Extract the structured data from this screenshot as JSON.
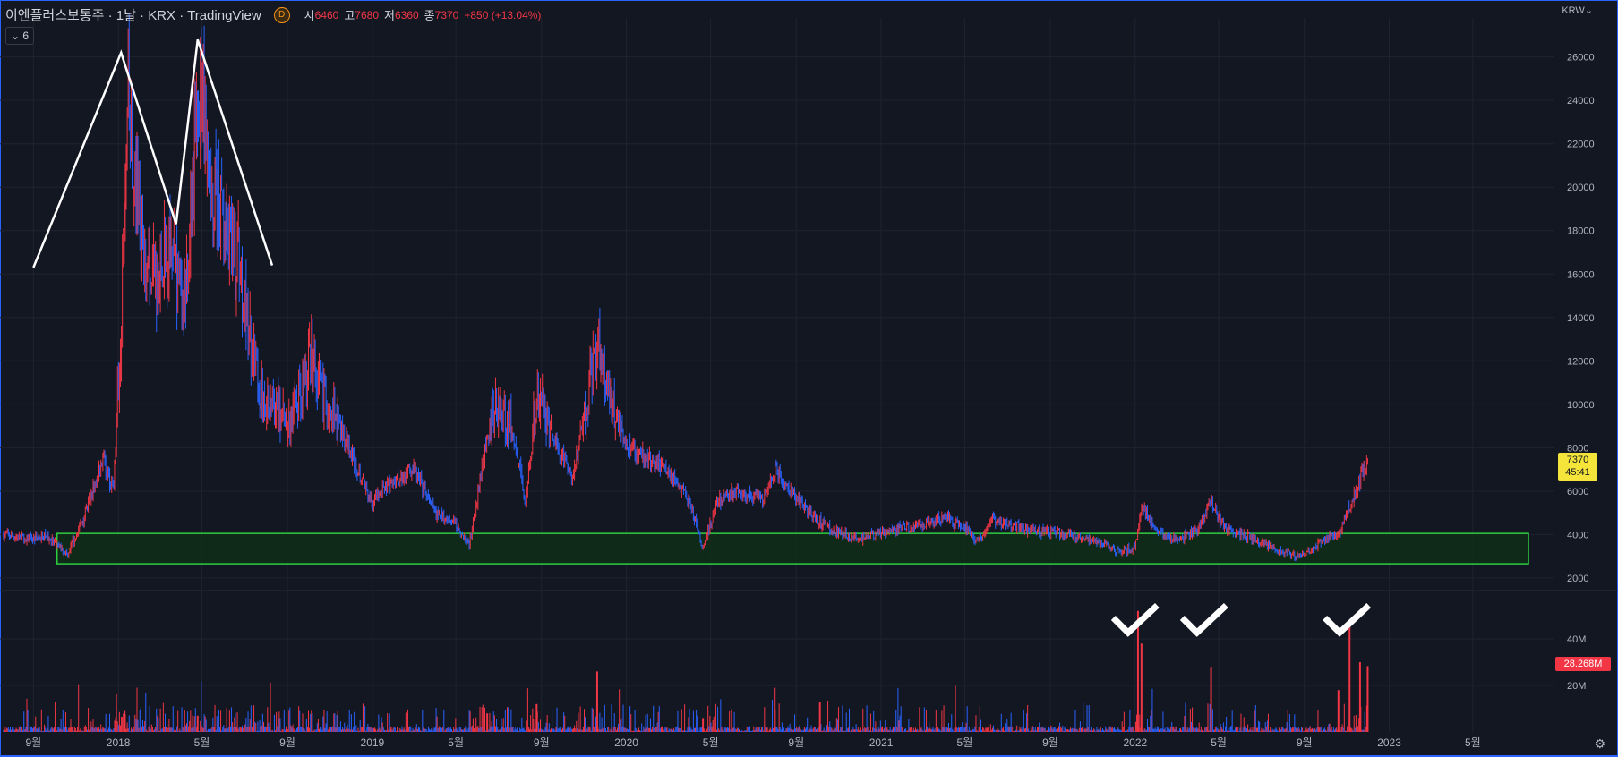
{
  "header": {
    "title": "이엔플러스보통주 · 1날 · KRX · TradingView",
    "badge": "D",
    "open_label": "시",
    "open_value": "6460",
    "high_label": "고",
    "high_value": "7680",
    "low_label": "저",
    "low_value": "6360",
    "close_label": "종",
    "close_value": "7370",
    "change": "+850 (+13.04%)",
    "collapse_label": "⌄ 6"
  },
  "currency": "KRW",
  "price_label": {
    "price": "7370",
    "countdown": "45:41"
  },
  "volume_label": "28.268M",
  "colors": {
    "up": "#f23645",
    "down": "#2962ff",
    "zone_border": "#2ecc40",
    "zone_fill": "#0f2e18",
    "annotation": "#ffffff"
  },
  "chart_data": {
    "type": "candlestick",
    "symbol": "KRX",
    "y_ticks": [
      "26000",
      "24000",
      "22000",
      "20000",
      "18000",
      "16000",
      "14000",
      "12000",
      "10000",
      "8000",
      "6000",
      "4000",
      "2000"
    ],
    "ylim": [
      1500,
      27800
    ],
    "volume_ticks": [
      "40M",
      "20M"
    ],
    "volume_ylim": [
      0,
      60
    ],
    "x_ticks": [
      {
        "date": "2017-09-01",
        "label": "9월"
      },
      {
        "date": "2018-01-01",
        "label": "2018"
      },
      {
        "date": "2018-05-01",
        "label": "5월"
      },
      {
        "date": "2018-09-01",
        "label": "9월"
      },
      {
        "date": "2019-01-01",
        "label": "2019"
      },
      {
        "date": "2019-05-01",
        "label": "5월"
      },
      {
        "date": "2019-09-01",
        "label": "9월"
      },
      {
        "date": "2020-01-01",
        "label": "2020"
      },
      {
        "date": "2020-05-01",
        "label": "5월"
      },
      {
        "date": "2020-09-01",
        "label": "9월"
      },
      {
        "date": "2021-01-01",
        "label": "2021"
      },
      {
        "date": "2021-05-01",
        "label": "5월"
      },
      {
        "date": "2021-09-01",
        "label": "9월"
      },
      {
        "date": "2022-01-01",
        "label": "2022"
      },
      {
        "date": "2022-05-01",
        "label": "5월"
      },
      {
        "date": "2022-09-01",
        "label": "9월"
      },
      {
        "date": "2023-01-01",
        "label": "2023"
      },
      {
        "date": "2023-05-01",
        "label": "5월"
      }
    ],
    "xlim": [
      "2017-07-15",
      "2023-08-25"
    ],
    "price_path": [
      [
        "2017-07-20",
        4000
      ],
      [
        "2017-08-20",
        3800
      ],
      [
        "2017-09-20",
        3900
      ],
      [
        "2017-10-20",
        3100
      ],
      [
        "2017-11-15",
        5000
      ],
      [
        "2017-12-10",
        7500
      ],
      [
        "2017-12-25",
        6000
      ],
      [
        "2018-01-05",
        14000
      ],
      [
        "2018-01-15",
        24000
      ],
      [
        "2018-01-25",
        20000
      ],
      [
        "2018-02-10",
        17000
      ],
      [
        "2018-02-25",
        16000
      ],
      [
        "2018-03-15",
        17500
      ],
      [
        "2018-04-05",
        14000
      ],
      [
        "2018-04-15",
        19000
      ],
      [
        "2018-05-01",
        26000
      ],
      [
        "2018-05-10",
        20000
      ],
      [
        "2018-05-25",
        19000
      ],
      [
        "2018-06-10",
        18000
      ],
      [
        "2018-06-25",
        16000
      ],
      [
        "2018-07-10",
        13000
      ],
      [
        "2018-07-25",
        10500
      ],
      [
        "2018-08-15",
        10000
      ],
      [
        "2018-09-05",
        9000
      ],
      [
        "2018-09-20",
        10500
      ],
      [
        "2018-10-05",
        12000
      ],
      [
        "2018-10-25",
        10000
      ],
      [
        "2018-11-15",
        9000
      ],
      [
        "2018-12-10",
        7000
      ],
      [
        "2019-01-01",
        5500
      ],
      [
        "2019-02-01",
        6500
      ],
      [
        "2019-03-01",
        7000
      ],
      [
        "2019-04-01",
        5000
      ],
      [
        "2019-05-01",
        4500
      ],
      [
        "2019-05-20",
        3500
      ],
      [
        "2019-06-10",
        7500
      ],
      [
        "2019-06-25",
        10000
      ],
      [
        "2019-07-20",
        9000
      ],
      [
        "2019-08-10",
        5500
      ],
      [
        "2019-08-25",
        10500
      ],
      [
        "2019-09-20",
        8500
      ],
      [
        "2019-10-15",
        6500
      ],
      [
        "2019-11-01",
        9500
      ],
      [
        "2019-11-20",
        12500
      ],
      [
        "2019-12-10",
        10000
      ],
      [
        "2020-01-01",
        8000
      ],
      [
        "2020-02-01",
        7500
      ],
      [
        "2020-03-01",
        7000
      ],
      [
        "2020-04-01",
        5500
      ],
      [
        "2020-04-20",
        3400
      ],
      [
        "2020-05-10",
        5500
      ],
      [
        "2020-06-10",
        6000
      ],
      [
        "2020-07-15",
        5500
      ],
      [
        "2020-08-01",
        7000
      ],
      [
        "2020-08-25",
        6000
      ],
      [
        "2020-09-20",
        5000
      ],
      [
        "2020-10-20",
        4200
      ],
      [
        "2020-12-01",
        3800
      ],
      [
        "2021-01-15",
        4200
      ],
      [
        "2021-03-01",
        4400
      ],
      [
        "2021-04-01",
        4800
      ],
      [
        "2021-05-01",
        4300
      ],
      [
        "2021-05-20",
        3700
      ],
      [
        "2021-06-10",
        4700
      ],
      [
        "2021-08-01",
        4200
      ],
      [
        "2021-10-01",
        4000
      ],
      [
        "2021-11-15",
        3600
      ],
      [
        "2021-12-10",
        3200
      ],
      [
        "2022-01-01",
        3400
      ],
      [
        "2022-01-10",
        5300
      ],
      [
        "2022-02-01",
        4200
      ],
      [
        "2022-03-01",
        3700
      ],
      [
        "2022-04-01",
        4300
      ],
      [
        "2022-04-20",
        5500
      ],
      [
        "2022-05-10",
        4300
      ],
      [
        "2022-06-20",
        3800
      ],
      [
        "2022-07-20",
        3300
      ],
      [
        "2022-08-20",
        3000
      ],
      [
        "2022-09-10",
        3200
      ],
      [
        "2022-10-01",
        3900
      ],
      [
        "2022-10-20",
        4000
      ],
      [
        "2022-11-01",
        5000
      ],
      [
        "2022-11-20",
        6500
      ],
      [
        "2022-12-01",
        7370
      ]
    ],
    "annotations": {
      "zone": {
        "from": "2017-10-05",
        "to": "2023-07-20",
        "low": 2650,
        "high": 4050
      },
      "double_top": [
        [
          "2017-09-01",
          16300
        ],
        [
          "2018-01-05",
          26200
        ],
        [
          "2018-03-25",
          18300
        ],
        [
          "2018-04-25",
          26800
        ],
        [
          "2018-08-10",
          16400
        ]
      ],
      "volume_checks": [
        "2022-01-01",
        "2022-04-10",
        "2022-11-01"
      ]
    }
  }
}
